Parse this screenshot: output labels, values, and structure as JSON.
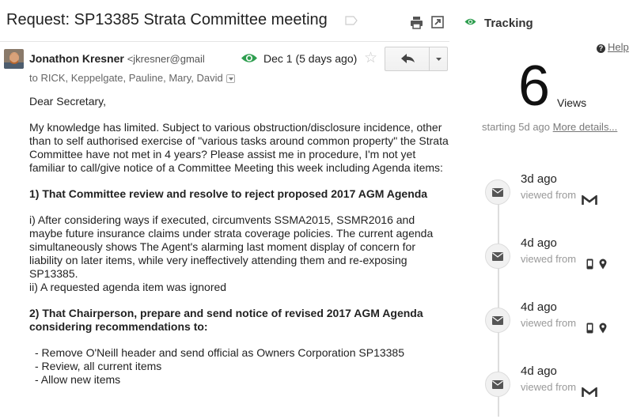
{
  "email": {
    "subject": "Request: SP13385 Strata Committee meeting",
    "sender_name": "Jonathon Kresner",
    "sender_email": "<jkresner@gmail",
    "date": "Dec 1 (5 days ago)",
    "recipients": "to RICK, Keppelgate, Pauline, Mary, David",
    "icons": {
      "label": "label-icon",
      "print": "print-icon",
      "new_window": "new-window-icon",
      "read_receipt": "eye-icon",
      "star": "star-icon",
      "reply": "reply-icon",
      "more": "chevron-down-icon"
    },
    "body": {
      "greeting": "Dear Secretary,",
      "intro": "My knowledge has limited. Subject to various obstruction/disclosure incidence, other than to self authorised exercise of \"various tasks around common property\" the Strata Committee have not met in 4 years? Please assist me in procedure, I'm not yet familiar to call/give notice of a Committee Meeting this week including Agenda items:",
      "item1_heading": "1) That Committee review and resolve to reject proposed 2017 AGM Agenda",
      "item1_i": "i) After considering ways if executed, circumvents SSMA2015, SSMR2016 and maybe future insurance claims under strata coverage policies. The current agenda simultaneously shows The Agent's alarming last moment display of concern for liability on later items, while very ineffectively attending them and re-exposing SP13385.",
      "item1_ii": "ii) A requested agenda item was ignored",
      "item2_heading": "2) That Chairperson, prepare and send notice of revised 2017 AGM Agenda considering  recommendations to:",
      "bullets": [
        "- Remove O'Neill header and send official as Owners Corporation SP13385",
        "- Review, all current items",
        "- Allow new items"
      ]
    }
  },
  "tracking": {
    "title": "Tracking",
    "help": "Help",
    "views_count": "6",
    "views_label": "Views",
    "starting": "starting 5d ago",
    "more_details": "More details...",
    "colors": {
      "accent": "#2e9e4f",
      "timeline": "#dddddd"
    },
    "events": [
      {
        "time": "3d ago",
        "from_label": "viewed from",
        "device": "gmail-icon"
      },
      {
        "time": "4d ago",
        "from_label": "viewed from",
        "device": "mobile-location-icon"
      },
      {
        "time": "4d ago",
        "from_label": "viewed from",
        "device": "mobile-location-icon"
      },
      {
        "time": "4d ago",
        "from_label": "viewed from",
        "device": "gmail-icon"
      }
    ]
  }
}
